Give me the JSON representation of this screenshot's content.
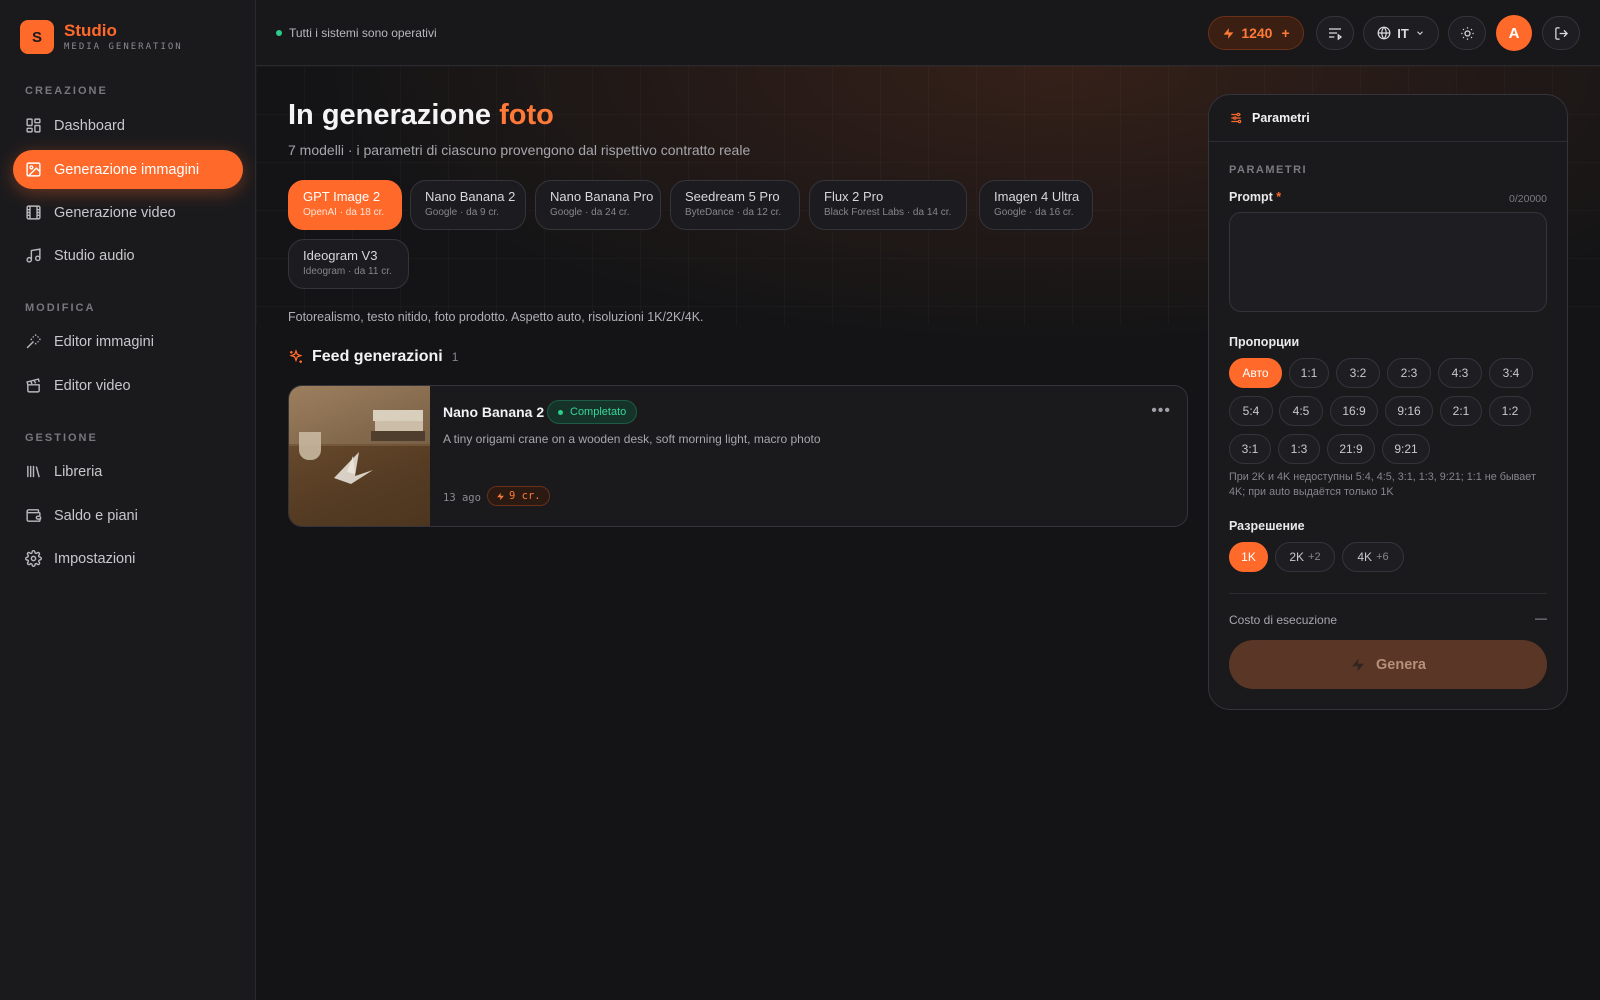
{
  "brand": {
    "logo_letter": "S",
    "name": "Studio",
    "subtitle": "MEDIA GENERATION"
  },
  "sidebar": {
    "sections": [
      {
        "label": "CREAZIONE"
      },
      {
        "label": "MODIFICA"
      },
      {
        "label": "GESTIONE"
      }
    ],
    "items": [
      {
        "label": "Dashboard",
        "icon": "dashboard-icon"
      },
      {
        "label": "Generazione immagini",
        "icon": "image-icon",
        "active": true
      },
      {
        "label": "Generazione video",
        "icon": "film-icon"
      },
      {
        "label": "Studio audio",
        "icon": "music-note-icon"
      },
      {
        "label": "Editor immagini",
        "icon": "magic-wand-icon"
      },
      {
        "label": "Editor video",
        "icon": "clapperboard-icon"
      },
      {
        "label": "Libreria",
        "icon": "library-icon"
      },
      {
        "label": "Saldo e piani",
        "icon": "wallet-icon"
      },
      {
        "label": "Impostazioni",
        "icon": "gear-icon"
      }
    ]
  },
  "topbar": {
    "status": "Tutti i sistemi sono operativi",
    "credits": "1240",
    "credits_plus": "+",
    "language": "IT",
    "avatar_letter": "A"
  },
  "page": {
    "title_main": "In generazione",
    "title_accent": "foto",
    "subtitle": "7 modelli · i parametri di ciascuno provengono dal rispettivo contratto reale",
    "models": [
      {
        "name": "GPT Image 2",
        "meta": "OpenAI · da 18 cr.",
        "active": true
      },
      {
        "name": "Nano Banana 2",
        "meta": "Google · da 9 cr."
      },
      {
        "name": "Nano Banana Pro",
        "meta": "Google · da 24 cr."
      },
      {
        "name": "Seedream 5 Pro",
        "meta": "ByteDance · da 12 cr."
      },
      {
        "name": "Flux 2 Pro",
        "meta": "Black Forest Labs · da 14 cr."
      },
      {
        "name": "Imagen 4 Ultra",
        "meta": "Google · da 16 cr."
      },
      {
        "name": "Ideogram V3",
        "meta": "Ideogram · da 11 cr."
      }
    ],
    "model_description": "Fotorealismo, testo nitido, foto prodotto. Aspetto auto, risoluzioni 1K/2K/4K.",
    "feed": {
      "title": "Feed generazioni",
      "count": "1",
      "items": [
        {
          "title": "Nano Banana 2",
          "status": "Completato",
          "prompt": "A tiny origami crane on a wooden desk, soft morning light, macro photo",
          "time": "13 ago",
          "cost": "9 cr."
        }
      ]
    }
  },
  "panel": {
    "title": "Parametri",
    "section_label": "PARAMETRI",
    "prompt_label": "Prompt",
    "prompt_required": "*",
    "prompt_counter": "0/20000",
    "prompt_value": "",
    "ratio_label": "Пропорции",
    "ratios": [
      "Авто",
      "1:1",
      "3:2",
      "2:3",
      "4:3",
      "3:4",
      "5:4",
      "4:5",
      "16:9",
      "9:16",
      "2:1",
      "1:2",
      "3:1",
      "1:3",
      "21:9",
      "9:21"
    ],
    "ratio_note": "При 2K и 4K недоступны 5:4, 4:5, 3:1, 1:3, 9:21; 1:1 не бывает 4K; при auto выдаётся только 1K",
    "resolution_label": "Разрешение",
    "resolutions": [
      {
        "label": "1K",
        "extra": ""
      },
      {
        "label": "2K",
        "extra": "+2"
      },
      {
        "label": "4K",
        "extra": "+6"
      }
    ],
    "cost_label": "Costo di esecuzione",
    "cost_value": "—",
    "generate_label": "Genera"
  },
  "colors": {
    "accent": "#ff6a2b",
    "success": "#38d69a",
    "background": "#141416"
  }
}
